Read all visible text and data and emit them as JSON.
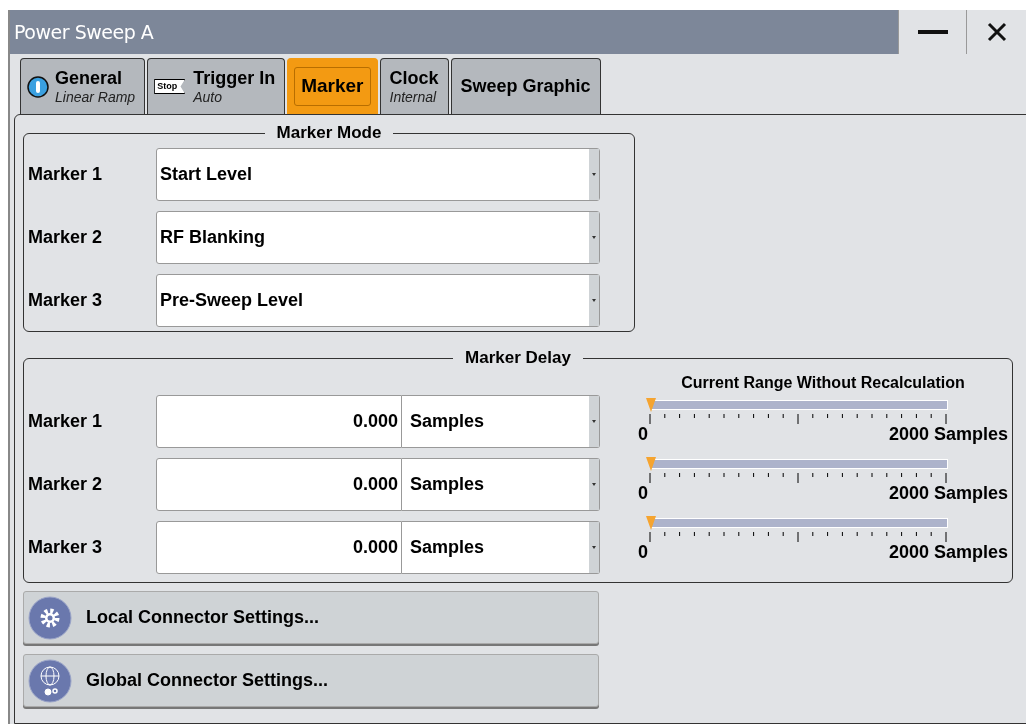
{
  "window": {
    "title": "Power Sweep A"
  },
  "tabs": [
    {
      "label": "General",
      "sublabel": "Linear Ramp",
      "kind": "info",
      "selected": false
    },
    {
      "label": "Trigger In",
      "sublabel": "Auto",
      "kind": "stop",
      "selected": false
    },
    {
      "label": "Marker",
      "selected": true
    },
    {
      "label": "Clock",
      "sublabel": "Internal",
      "selected": false
    },
    {
      "label": "Sweep Graphic",
      "selected": false
    }
  ],
  "stop_icon_text": "Stop",
  "marker_mode": {
    "title": "Marker Mode",
    "rows": [
      {
        "label": "Marker 1",
        "value": "Start Level"
      },
      {
        "label": "Marker 2",
        "value": "RF Blanking"
      },
      {
        "label": "Marker 3",
        "value": "Pre-Sweep Level"
      }
    ]
  },
  "marker_delay": {
    "title": "Marker Delay",
    "range_title": "Current Range Without Recalculation",
    "rows": [
      {
        "label": "Marker 1",
        "value": "0.000",
        "unit": "Samples",
        "level": 0,
        "min": "0",
        "max": "2000 Samples"
      },
      {
        "label": "Marker 2",
        "value": "0.000",
        "unit": "Samples",
        "level": 0,
        "min": "0",
        "max": "2000 Samples"
      },
      {
        "label": "Marker 3",
        "value": "0.000",
        "unit": "Samples",
        "level": 0,
        "min": "0",
        "max": "2000 Samples"
      }
    ]
  },
  "buttons": [
    {
      "label": "Local Connector Settings...",
      "kind": "gear"
    },
    {
      "label": "Global Connector Settings...",
      "kind": "globe"
    }
  ]
}
